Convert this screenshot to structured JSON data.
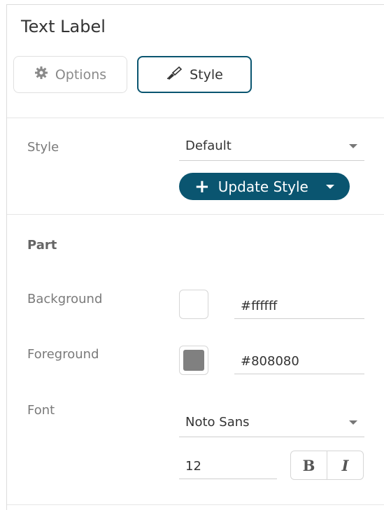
{
  "panel": {
    "title": "Text Label"
  },
  "tabs": [
    {
      "label": "Options",
      "icon": "gear-icon",
      "active": false
    },
    {
      "label": "Style",
      "icon": "paint-brush-icon",
      "active": true
    }
  ],
  "style_section": {
    "label": "Style",
    "selected": "Default",
    "update_button": {
      "label": "Update Style",
      "icon": "plus-icon"
    }
  },
  "part_section": {
    "heading": "Part",
    "background": {
      "label": "Background",
      "color": "#ffffff",
      "value": "#ffffff"
    },
    "foreground": {
      "label": "Foreground",
      "color": "#808080",
      "value": "#808080"
    },
    "font": {
      "label": "Font",
      "family": "Noto Sans",
      "size": "12",
      "bold_label": "B",
      "italic_label": "I"
    }
  },
  "colors": {
    "accent": "#0a5570"
  }
}
